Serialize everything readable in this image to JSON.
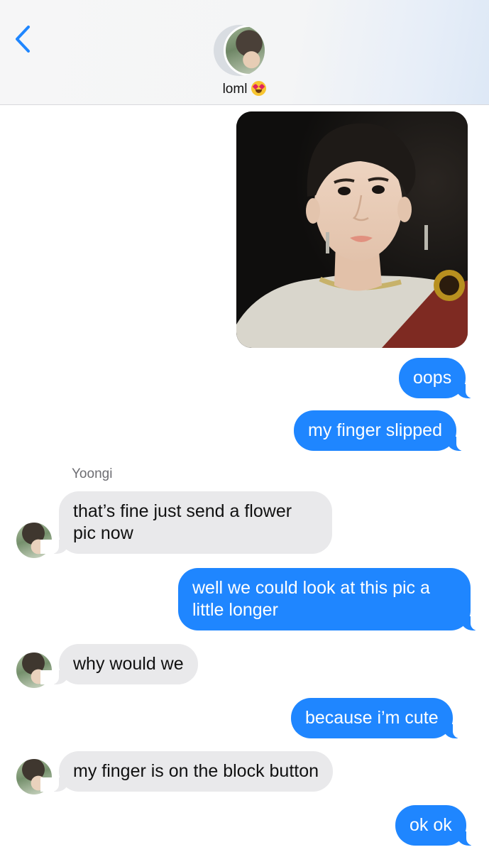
{
  "header": {
    "back_icon": "chevron-left-icon",
    "contact_name": "loml",
    "contact_emoji": "heart-eyes-emoji",
    "accent_color": "#1f86ff"
  },
  "conversation": {
    "sender_label": "Yoongi",
    "messages": [
      {
        "from": "me",
        "type": "photo"
      },
      {
        "from": "me",
        "text": "oops"
      },
      {
        "from": "me",
        "text": "my finger slipped"
      },
      {
        "from": "them",
        "line1": "that’s fine just send a flower",
        "line2": "pic now"
      },
      {
        "from": "me",
        "line1": "well we could look at this pic a",
        "line2": "little longer"
      },
      {
        "from": "them",
        "text": "why would we"
      },
      {
        "from": "me",
        "text": "because i’m cute"
      },
      {
        "from": "them",
        "text": "my finger is on the block button"
      },
      {
        "from": "me",
        "text": "ok ok"
      }
    ],
    "colors": {
      "sent_bubble": "#1f86ff",
      "received_bubble": "#e9e9eb"
    }
  }
}
